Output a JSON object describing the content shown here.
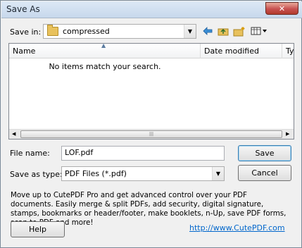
{
  "window": {
    "title": "Save As",
    "close_glyph": "✕"
  },
  "save_in": {
    "label": "Save in:",
    "value": "compressed"
  },
  "toolbar": {
    "back_icon": "arrow-left-icon",
    "up_icon": "up-folder-icon",
    "new_folder_icon": "new-folder-icon",
    "views_icon": "view-menu-icon"
  },
  "file_list": {
    "columns": [
      "Name",
      "Date modified",
      "Ty"
    ],
    "empty_message": "No items match your search.",
    "scroll_grip": "|||"
  },
  "file_name": {
    "label": "File name:",
    "value": "LOF.pdf"
  },
  "save_as_type": {
    "label": "Save as type:",
    "value": "PDF Files (*.pdf)"
  },
  "buttons": {
    "save": "Save",
    "cancel": "Cancel",
    "help": "Help"
  },
  "promo": {
    "text": "Move up to CutePDF Pro and get advanced control over your PDF documents. Easily merge & split PDFs, add security, digital signature, stamps, bookmarks or header/footer, make booklets, n-Up, save PDF forms, scan to PDF and more!",
    "link": "http://www.CutePDF.com"
  }
}
